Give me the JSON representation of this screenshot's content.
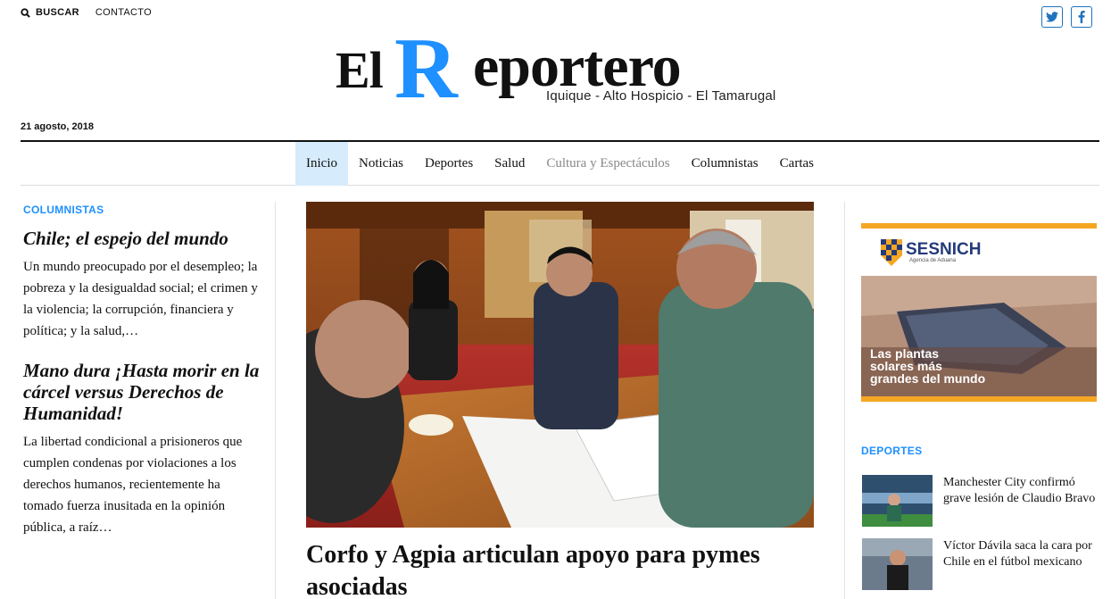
{
  "topbar": {
    "search_label": "BUSCAR",
    "contact_label": "CONTACTO"
  },
  "social": {
    "twitter_glyph": "t",
    "facebook_glyph": "f"
  },
  "logo": {
    "el": "El",
    "r": "R",
    "rest": "eportero",
    "tagline": "Iquique - Alto Hospicio - El Tamarugal"
  },
  "date": "21 agosto, 2018",
  "nav": {
    "items": [
      {
        "label": "Inicio",
        "active": true
      },
      {
        "label": "Noticias"
      },
      {
        "label": "Deportes"
      },
      {
        "label": "Salud"
      },
      {
        "label": "Cultura y Espectáculos"
      },
      {
        "label": "Columnistas"
      },
      {
        "label": "Cartas"
      }
    ]
  },
  "columnistas": {
    "label": "COLUMNISTAS",
    "articles": [
      {
        "title": "Chile; el espejo del mundo",
        "excerpt": "Un mundo preocupado por el desempleo; la pobreza y la desigualdad social; el crimen y la violencia; la corrupción, financiera y política; y la salud,…"
      },
      {
        "title": "Mano dura ¡Hasta morir en la cárcel versus Derechos de Humanidad!",
        "excerpt": "La libertad condicional a prisioneros que cumplen condenas por violaciones a los derechos humanos, recientemente ha tomado fuerza inusitada en la opinión pública, a raíz…"
      }
    ]
  },
  "main": {
    "headline": "Corfo y Agpia articulan apoyo para pymes asociadas"
  },
  "ad": {
    "brand": "SESNICH",
    "brand_sub": "Agencia de Aduana",
    "caption": [
      "Las plantas",
      "solares más",
      "grandes del mundo"
    ]
  },
  "deportes": {
    "label": "DEPORTES",
    "items": [
      {
        "title": "Manchester City confirmó grave lesión de Claudio Bravo"
      },
      {
        "title": "Víctor Dávila saca la cara por Chile en el fútbol mexicano"
      }
    ]
  },
  "colors": {
    "accent": "#1e90ff",
    "ad_border": "#f5a623",
    "nav_active": "#d6ebfb"
  }
}
